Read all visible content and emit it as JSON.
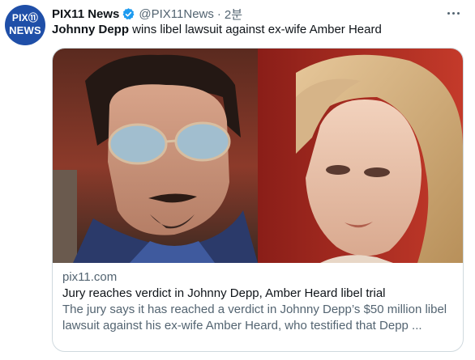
{
  "account": {
    "avatar_line1": "PIX⑪",
    "avatar_line2": "NEWS",
    "name": "PIX11 News",
    "handle": "@PIX11News",
    "separator": "·",
    "time": "2분"
  },
  "tweet": {
    "bold": "Johnny Depp",
    "text": " wins libel lawsuit against ex-wife Amber Heard"
  },
  "card": {
    "domain": "pix11.com",
    "title": "Jury reaches verdict in Johnny Depp, Amber Heard libel trial",
    "description_line1": "The jury says it has reached a verdict in Johnny Depp’s $50 million libel",
    "description_line2": "lawsuit against his ex-wife Amber Heard, who testified that Depp ..."
  },
  "icons": {
    "verified": "verified-badge-icon",
    "more": "more-options-icon"
  },
  "colors": {
    "brand_blue": "#1d9bf0",
    "avatar_bg": "#1f4fa8",
    "secondary_text": "#536471",
    "border": "#cfd9de"
  }
}
